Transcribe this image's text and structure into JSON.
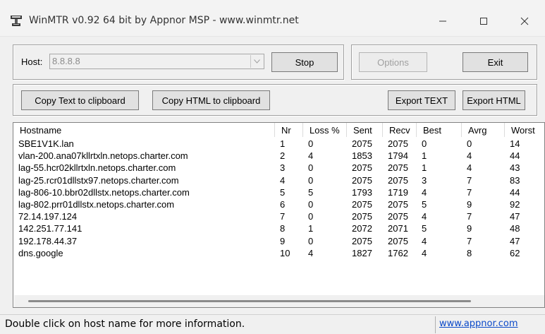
{
  "window": {
    "title": "WinMTR v0.92 64 bit by Appnor MSP - www.winmtr.net",
    "app_icon": "winmtr-icon",
    "controls": {
      "minimize": "minimize-icon",
      "maximize": "maximize-icon",
      "close": "close-icon"
    }
  },
  "host": {
    "label": "Host:",
    "value": "8.8.8.8",
    "stop_label": "Stop"
  },
  "options": {
    "options_label": "Options",
    "exit_label": "Exit"
  },
  "toolbar": {
    "copy_text_label": "Copy Text to clipboard",
    "copy_html_label": "Copy HTML to clipboard",
    "export_text_label": "Export TEXT",
    "export_html_label": "Export HTML"
  },
  "table": {
    "columns": [
      "Hostname",
      "Nr",
      "Loss %",
      "Sent",
      "Recv",
      "Best",
      "Avrg",
      "Worst"
    ],
    "rows": [
      [
        "SBE1V1K.lan",
        "1",
        "0",
        "2075",
        "2075",
        "0",
        "0",
        "14"
      ],
      [
        "vlan-200.ana07kllrtxln.netops.charter.com",
        "2",
        "4",
        "1853",
        "1794",
        "1",
        "4",
        "44"
      ],
      [
        "lag-55.hcr02kllrtxln.netops.charter.com",
        "3",
        "0",
        "2075",
        "2075",
        "1",
        "4",
        "43"
      ],
      [
        "lag-25.rcr01dllstx97.netops.charter.com",
        "4",
        "0",
        "2075",
        "2075",
        "3",
        "7",
        "83"
      ],
      [
        "lag-806-10.bbr02dllstx.netops.charter.com",
        "5",
        "5",
        "1793",
        "1719",
        "4",
        "7",
        "44"
      ],
      [
        "lag-802.prr01dllstx.netops.charter.com",
        "6",
        "0",
        "2075",
        "2075",
        "5",
        "9",
        "92"
      ],
      [
        "72.14.197.124",
        "7",
        "0",
        "2075",
        "2075",
        "4",
        "7",
        "47"
      ],
      [
        "142.251.77.141",
        "8",
        "1",
        "2072",
        "2071",
        "5",
        "9",
        "48"
      ],
      [
        "192.178.44.37",
        "9",
        "0",
        "2075",
        "2075",
        "4",
        "7",
        "47"
      ],
      [
        "dns.google",
        "10",
        "4",
        "1827",
        "1762",
        "4",
        "8",
        "62"
      ]
    ]
  },
  "status": {
    "text": "Double click on host name for more information.",
    "link": "www.appnor.com"
  }
}
